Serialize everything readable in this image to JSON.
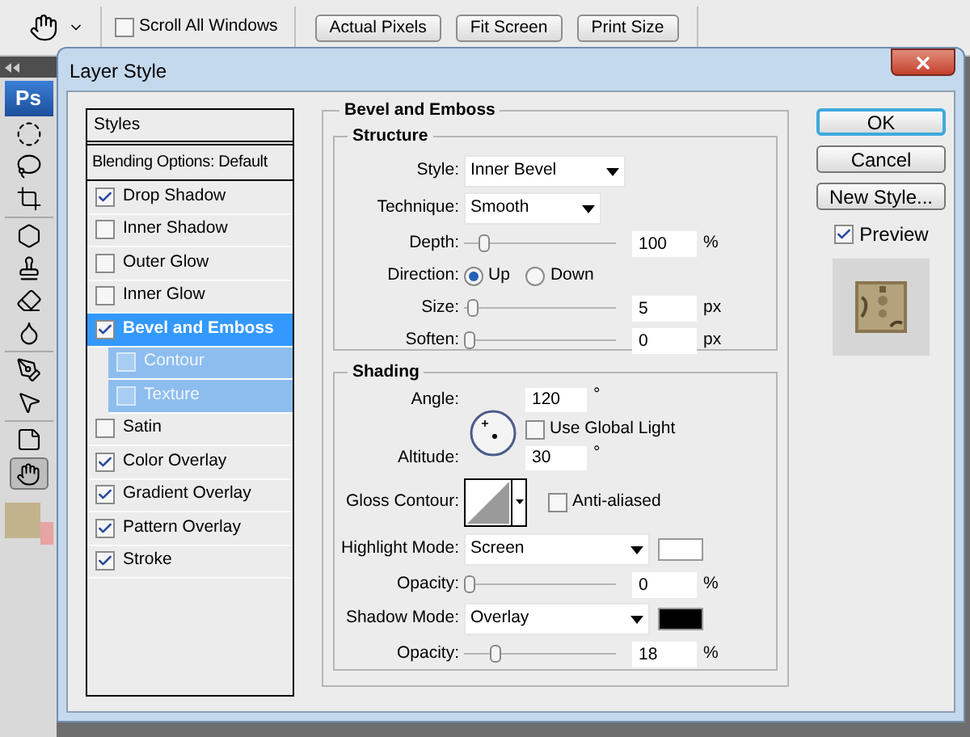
{
  "toolbar": {
    "scroll_all_windows": {
      "label": "Scroll All Windows",
      "checked": false
    },
    "buttons": [
      "Actual Pixels",
      "Fit Screen",
      "Print Size"
    ]
  },
  "tools": {
    "logo": "Ps",
    "swatches": [
      {
        "kind": "foreground",
        "color": "#c3b38d"
      },
      {
        "kind": "background",
        "color": "#e8a3a3"
      }
    ]
  },
  "dialog": {
    "title": "Layer Style",
    "styles_header": "Styles",
    "blending_options": "Blending Options: Default",
    "effects": [
      {
        "label": "Drop Shadow",
        "checked": true,
        "selected": false
      },
      {
        "label": "Inner Shadow",
        "checked": false,
        "selected": false
      },
      {
        "label": "Outer Glow",
        "checked": false,
        "selected": false
      },
      {
        "label": "Inner Glow",
        "checked": false,
        "selected": false
      },
      {
        "label": "Bevel and Emboss",
        "checked": true,
        "selected": true,
        "children": [
          {
            "label": "Contour",
            "checked": false,
            "selected": false
          },
          {
            "label": "Texture",
            "checked": false,
            "selected": false
          }
        ]
      },
      {
        "label": "Satin",
        "checked": false,
        "selected": false
      },
      {
        "label": "Color Overlay",
        "checked": true,
        "selected": false
      },
      {
        "label": "Gradient Overlay",
        "checked": true,
        "selected": false
      },
      {
        "label": "Pattern Overlay",
        "checked": true,
        "selected": false
      },
      {
        "label": "Stroke",
        "checked": true,
        "selected": false
      }
    ],
    "section_title": "Bevel and Emboss",
    "structure": {
      "title": "Structure",
      "style": {
        "label": "Style:",
        "value": "Inner Bevel"
      },
      "technique": {
        "label": "Technique:",
        "value": "Smooth"
      },
      "depth": {
        "label": "Depth:",
        "level": 0.1,
        "value": "100",
        "unit": "%"
      },
      "direction": {
        "label": "Direction:",
        "options": [
          {
            "label": "Up",
            "selected": true
          },
          {
            "label": "Down",
            "selected": false
          }
        ]
      },
      "size": {
        "label": "Size:",
        "level": 0.02,
        "value": "5",
        "unit": "px"
      },
      "soften": {
        "label": "Soften:",
        "level": 0,
        "value": "0",
        "unit": "px"
      }
    },
    "shading": {
      "title": "Shading",
      "angle": {
        "label": "Angle:",
        "value": "120",
        "unit": "°"
      },
      "use_global_light": {
        "label": "Use Global Light",
        "checked": false
      },
      "altitude": {
        "label": "Altitude:",
        "value": "30",
        "unit": "°"
      },
      "gloss_contour": {
        "label": "Gloss Contour:"
      },
      "anti_aliased": {
        "label": "Anti-aliased",
        "checked": false
      },
      "highlight_mode": {
        "label": "Highlight Mode:",
        "value": "Screen",
        "color": "#ffffff"
      },
      "highlight_opacity": {
        "label": "Opacity:",
        "level": 0,
        "value": "0",
        "unit": "%"
      },
      "shadow_mode": {
        "label": "Shadow Mode:",
        "value": "Overlay",
        "color": "#000000"
      },
      "shadow_opacity": {
        "label": "Opacity:",
        "level": 0.18,
        "value": "18",
        "unit": "%"
      }
    },
    "buttons": [
      {
        "label": "OK",
        "default": true
      },
      {
        "label": "Cancel",
        "default": false
      },
      {
        "label": "New Style...",
        "default": false
      }
    ],
    "preview": {
      "label": "Preview",
      "checked": true
    }
  }
}
